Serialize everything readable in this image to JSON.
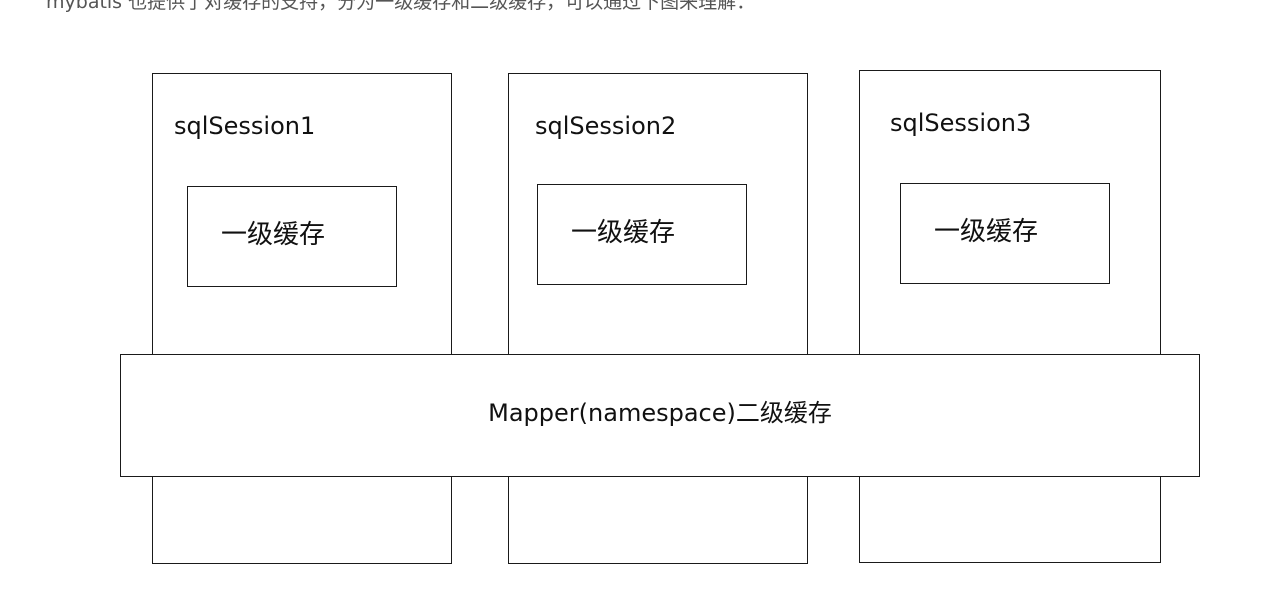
{
  "intro_text": "mybatis 也提供了对缓存的支持，分为一级缓存和二级缓存，可以通过下图来理解：",
  "sessions": [
    {
      "title": "sqlSession1",
      "cache_label": "一级缓存"
    },
    {
      "title": "sqlSession2",
      "cache_label": "一级缓存"
    },
    {
      "title": "sqlSession3",
      "cache_label": "一级缓存"
    }
  ],
  "mapper": {
    "label": "Mapper(namespace)二级缓存"
  },
  "colors": {
    "stroke": "#1a1a1a",
    "background": "#ffffff",
    "intro_text": "#555555"
  }
}
